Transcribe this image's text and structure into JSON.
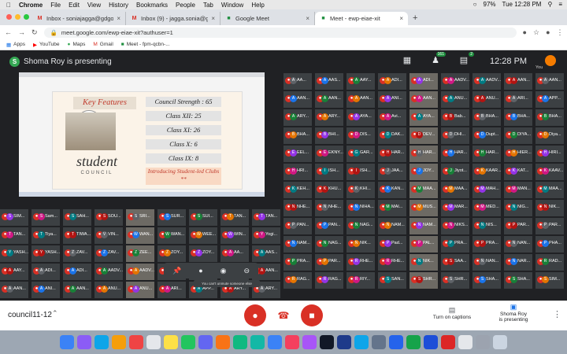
{
  "macbar": {
    "apple": "",
    "app": "Chrome",
    "menus": [
      "File",
      "Edit",
      "View",
      "History",
      "Bookmarks",
      "People",
      "Tab",
      "Window",
      "Help"
    ],
    "battery": "97%",
    "datetime": "Tue 12:28 PM"
  },
  "tabs": [
    {
      "icon": "gmail-icon",
      "title": "Inbox - soniajagga@gdgoenk..."
    },
    {
      "icon": "gmail-icon",
      "title": "Inbox (9) - jagga.sonia@gmai..."
    },
    {
      "icon": "meet-icon",
      "title": "Google Meet"
    },
    {
      "icon": "meet-icon",
      "title": "Meet - ewp-eiae-xit"
    }
  ],
  "url": "meet.google.com/ewp-eiae-xit?authuser=1",
  "bookmarks": [
    "Apps",
    "YouTube",
    "Maps",
    "Gmail",
    "Meet - fpm-qcbn-..."
  ],
  "meet": {
    "presenter_initial": "S",
    "presenting_text": "Shoma Roy is presenting",
    "people_count": "161",
    "chat_count": "2",
    "clock": "12:28 PM",
    "you_initial": "",
    "you_label": "You",
    "meeting_code": "council11-12",
    "captions_label": "Turn on captions",
    "presenting_label": "Shoma Roy\nis presenting",
    "share_tip": "You can't unmute someone else"
  },
  "slide": {
    "title": "Key Features",
    "logo_text": "GD GOENKA",
    "word1": "student",
    "word2": "COUNCIL",
    "rows": [
      "Council Strength : 65",
      "Class XII: 25",
      "Class XI: 26",
      "Class X: 6",
      "Class IX: 8",
      "Introducing Student-led Clubs **"
    ]
  },
  "colors": {
    "accent_red": "#d93025",
    "meet_dark": "#202124"
  },
  "participants": [
    "AA...",
    "AAS...",
    "AAY...",
    "ADI...",
    "ADI...",
    "AADV...",
    "AADV...",
    "AAN...",
    "AAN...",
    "AAN...",
    "AAN...",
    "AAN...",
    "ANI...",
    "AAN...",
    "ANU...",
    "ANU...",
    "ARI...",
    "APP...",
    "ARY...",
    "ARY...",
    "AYA...",
    "Avi...",
    "AYA...",
    "Bab...",
    "BHA...",
    "BHA...",
    "BHA...",
    "BHA...",
    "BHI...",
    "DIS...",
    "DAK...",
    "DEV...",
    "DHI...",
    "Dupt...",
    "DIYA...",
    "Diya...",
    "EEL...",
    "EKNY...",
    "GAR...",
    "HAR...",
    "HAR...",
    "HAR...",
    "HAR...",
    "HIER...",
    "HIRI...",
    "HRI...",
    "ISH...",
    "ISH...",
    "JAA...",
    "JOY...",
    "Jiyot...",
    "KAAR...",
    "KAT...",
    "KAAV...",
    "KEH...",
    "KHU...",
    "KHI...",
    "KAN...",
    "MAA...",
    "MAA...",
    "MAH...",
    "MAN...",
    "MAA...",
    "NHE...",
    "NHE...",
    "NIHA...",
    "MAI...",
    "MUS...",
    "MAR...",
    "MED...",
    "NIG...",
    "NIK...",
    "PAN...",
    "PAN...",
    "NAG...",
    "NAM...",
    "NAM...",
    "NIKS...",
    "NIS...",
    "PAR...",
    "PAR...",
    "NAM...",
    "NAG...",
    "NIK...",
    "Pad...",
    "PAL...",
    "PRA...",
    "PRA...",
    "NAN...",
    "PHA...",
    "PRA...",
    "PAR...",
    "RHE...",
    "RHE...",
    "NIK...",
    "SAA...",
    "NAN...",
    "NAR...",
    "RAD...",
    "RAG...",
    "RAG...",
    "RIY...",
    "SAN...",
    "SHR...",
    "SHR...",
    "SHA...",
    "SHA...",
    "SIM...",
    "SIM...",
    "Sam...",
    "SAH...",
    "SOU...",
    "SRI...",
    "SUR...",
    "SUI...",
    "TAN...",
    "TAN...",
    "TAN...",
    "Tiya...",
    "TIWA...",
    "VIN...",
    "WAN...",
    "WAN...",
    "WEE...",
    "WIN...",
    "Yogi...",
    "YASH...",
    "YASH...",
    "ZAV...",
    "ZAV...",
    "ZEE...",
    "ZOY...",
    "ZOY..."
  ]
}
